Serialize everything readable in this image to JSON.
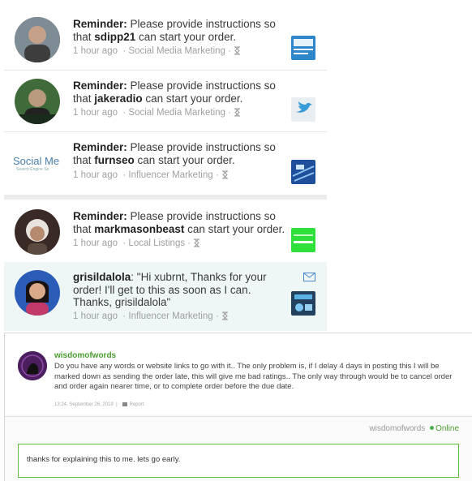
{
  "notifications": [
    {
      "prefix": "Reminder:",
      "text_before": " Please provide instructions so that ",
      "user": "sdipp21",
      "text_after": " can start your order.",
      "time": "1 hour ago",
      "category": "Social Media Marketing",
      "avatar_icon": "user-photo",
      "thumb_icon": "gig-thumbnail"
    },
    {
      "prefix": "Reminder:",
      "text_before": " Please provide instructions so that ",
      "user": "jakeradio",
      "text_after": " can start your order.",
      "time": "1 hour ago",
      "category": "Social Media Marketing",
      "avatar_icon": "user-photo",
      "thumb_icon": "twitter-bird-thumbnail"
    },
    {
      "prefix": "Reminder:",
      "text_before": " Please provide instructions so that ",
      "user": "furnseo",
      "text_after": " can start your order.",
      "time": "1 hour ago",
      "category": "Influencer Marketing",
      "avatar_logo_text": "Social Me",
      "avatar_logo_sub": "Search Engine Se",
      "thumb_icon": "gig-thumbnail"
    },
    {
      "prefix": "Reminder:",
      "text_before": " Please provide instructions so that ",
      "user": "markmasonbeast",
      "text_after": " can start your order.",
      "time": "1 hour ago",
      "category": "Local Listings",
      "avatar_icon": "user-photo",
      "thumb_icon": "green-thumbnail"
    },
    {
      "prefix": "",
      "text_before": "",
      "user": "grisildalola",
      "text_after": ": \"Hi xubrnt, Thanks for your order! I'll get to this as soon as I can. Thanks, grisildalola\"",
      "time": "1 hour ago",
      "category": "Influencer Marketing",
      "avatar_icon": "user-photo",
      "thumb_icon": "gig-thumbnail",
      "envelope_icon": "envelope-icon"
    }
  ],
  "conversation": {
    "sender": "wisdomofwords",
    "message": "Do you have any words or website links to go with it.. The only problem is, if I delay 4 days in posting this I will be marked down as sending the order late, this will give me bad ratings.. The only way through would be to cancel order and order again nearer time, or to complete order before the due date.",
    "timestamp": "13:24, September 26, 2018",
    "report_label": "Report",
    "status_user": "wisdomofwords",
    "status_label": "Online",
    "reply_value": "thanks for explaining this to me.  lets go early."
  },
  "colors": {
    "online": "#4a9d2f",
    "reply_border": "#5bbf3a",
    "highlight_bg": "#eef7f6"
  }
}
